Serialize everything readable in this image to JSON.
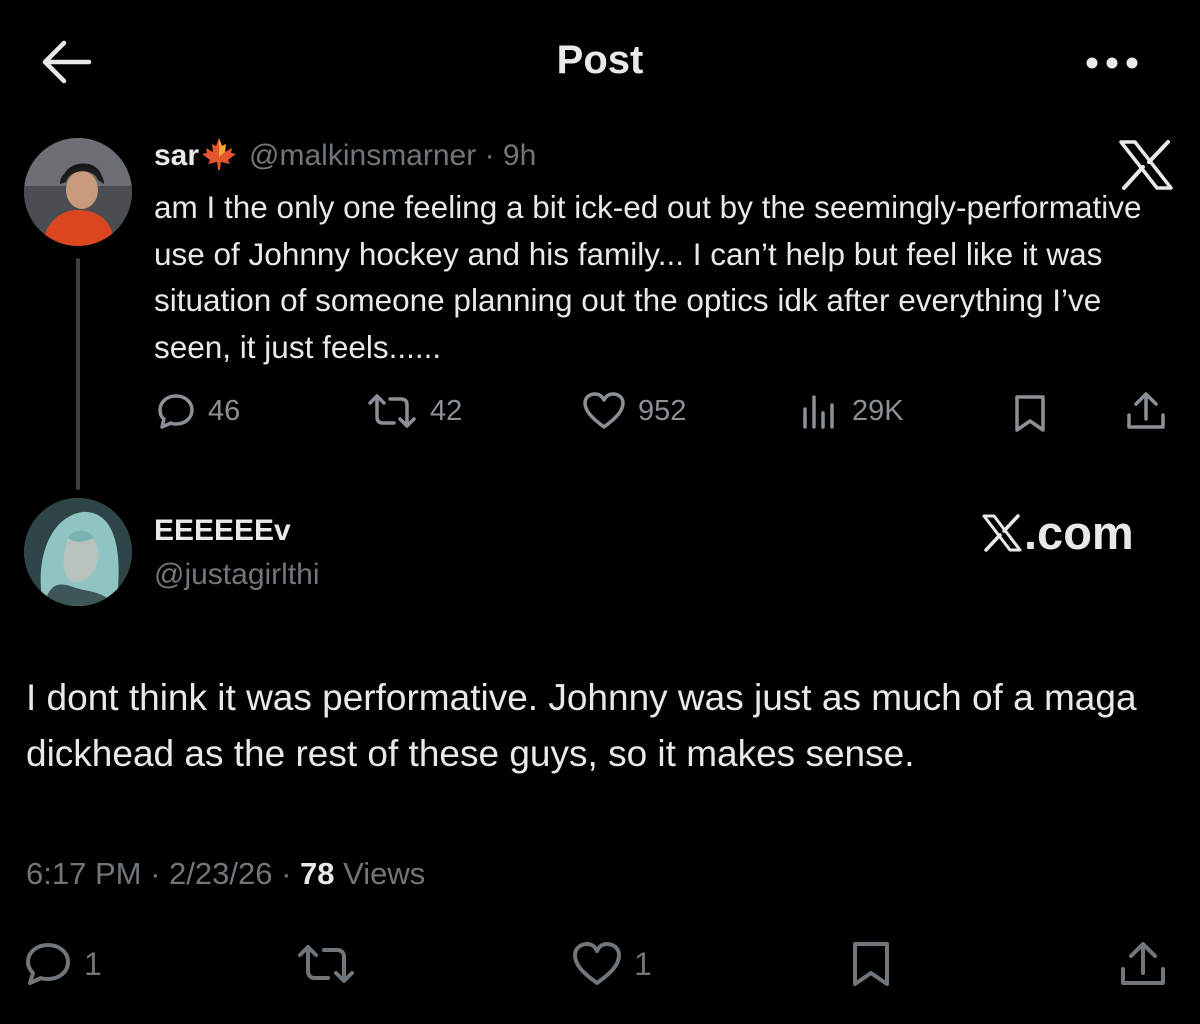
{
  "header": {
    "title": "Post",
    "back_icon": "arrow-left-icon",
    "more_icon": "more-horizontal-icon"
  },
  "quoted_post": {
    "display_name": "sar",
    "emoji": "maple-leaf-icon",
    "handle": "@malkinsmarner",
    "separator": "·",
    "age": "9h",
    "text": "am I the only one feeling a bit ick-ed out by the seemingly-performative use of Johnny hockey and his family... I can’t help but feel like it was situation of someone planning out the optics idk after everything I’ve seen, it just feels......",
    "stats": {
      "replies": "46",
      "reposts": "42",
      "likes": "952",
      "views": "29K"
    },
    "watermark_icon": "x-logo-icon"
  },
  "reply_post": {
    "display_name": "EEEEEEv",
    "handle": "@justagirlthi",
    "watermark": ".com",
    "text": "I dont think it was performative. Johnny was just as much of a maga dickhead as the rest of these guys, so it makes sense.",
    "meta": {
      "time": "6:17 PM",
      "sep1": "·",
      "date": "2/23/26",
      "sep2": "·",
      "views_count": "78",
      "views_label": "Views"
    },
    "actions": {
      "replies": "1",
      "likes": "1"
    }
  },
  "colors": {
    "background": "#000000",
    "text": "#e7e9ea",
    "muted": "#71767b",
    "thread_line": "#3c4044"
  }
}
